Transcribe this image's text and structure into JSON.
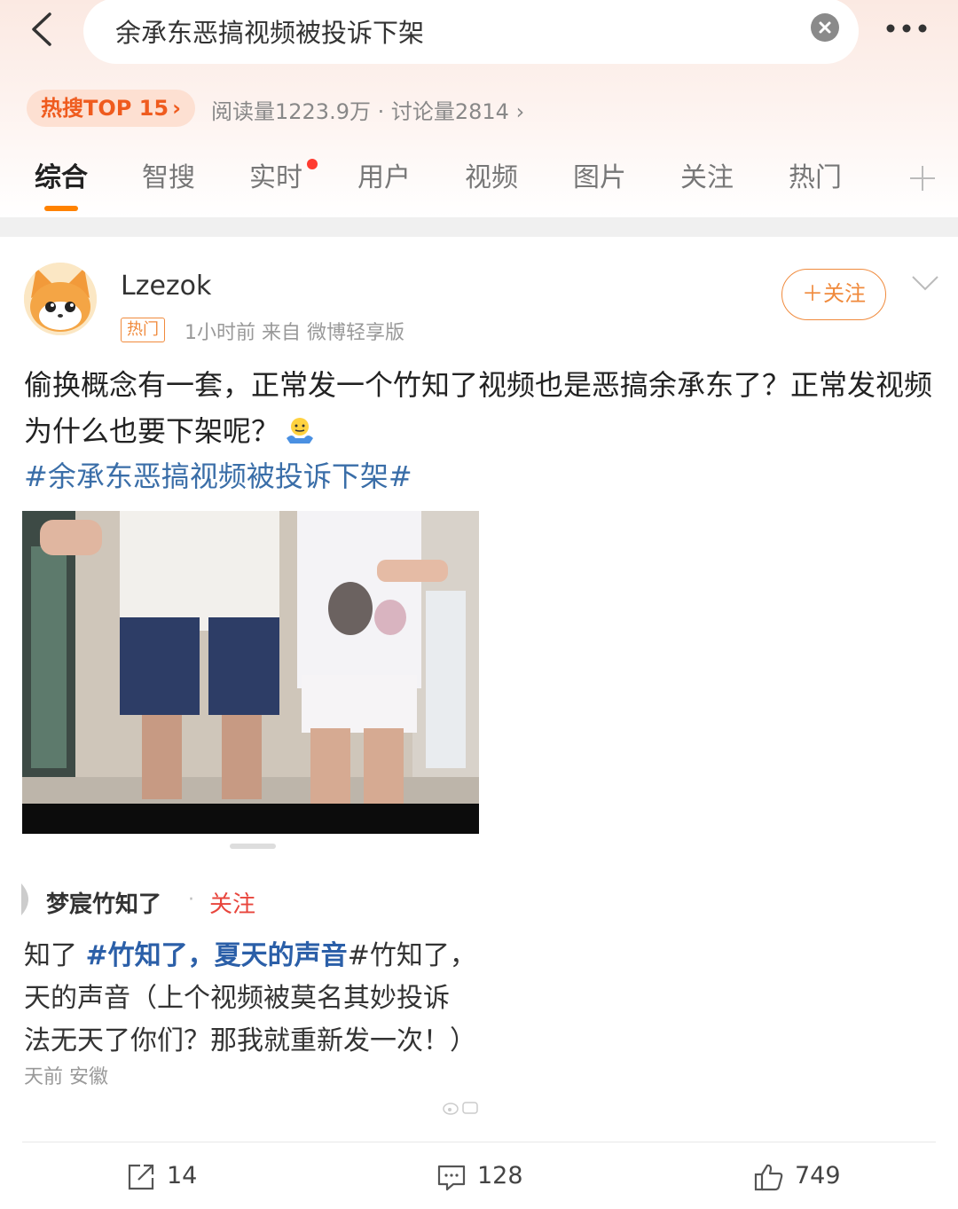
{
  "search": {
    "query": "余承东恶搞视频被投诉下架"
  },
  "hot": {
    "badge": "热搜TOP 15",
    "stats": "阅读量1223.9万 · 讨论量2814 ›"
  },
  "tabs": [
    "综合",
    "智搜",
    "实时",
    "用户",
    "视频",
    "图片",
    "关注",
    "热门"
  ],
  "post": {
    "username": "Lzezok",
    "tag": "热门",
    "meta": "1小时前   来自 微博轻享版",
    "follow_label": "＋关注",
    "text": "偷换概念有一套，正常发一个竹知了视频也是恶搞余承东了？正常发视频为什么也要下架呢？",
    "topic": "#余承东恶搞视频被投诉下架#"
  },
  "embedded": {
    "name": "梦宸竹知了",
    "dot": "·",
    "follow": "关注",
    "line1_prefix": "知了 ",
    "line1_blue": "#竹知了，夏天的声音",
    "line1_suffix": "#竹知了，",
    "line2": "天的声音（上个视频被莫名其妙投诉",
    "line3": "法无天了你们？那我就重新发一次！）",
    "meta": "天前 安徽"
  },
  "actions": {
    "repost": "14",
    "comment": "128",
    "like": "749"
  },
  "colors": {
    "accent": "#ff8200",
    "link": "#3a6ea8",
    "hot": "#ef5b1e",
    "follow": "#f08a3c"
  }
}
